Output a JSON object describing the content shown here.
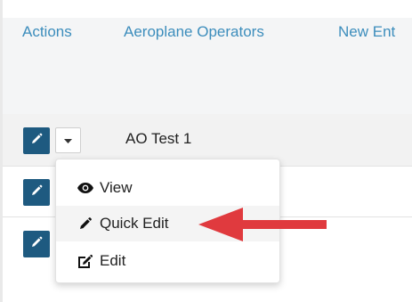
{
  "header": {
    "columns": [
      {
        "label": "Actions"
      },
      {
        "label": "Aeroplane Operators"
      },
      {
        "label": "New Ent"
      }
    ]
  },
  "rows": [
    {
      "name": "AO Test 1"
    },
    {
      "name": ""
    },
    {
      "name": ""
    }
  ],
  "dropdown": {
    "items": [
      {
        "label": "View",
        "icon": "eye-icon"
      },
      {
        "label": "Quick Edit",
        "icon": "pencil-icon"
      },
      {
        "label": "Edit",
        "icon": "edit-square-icon"
      }
    ]
  },
  "colors": {
    "link": "#3c8dbc",
    "edit_button": "#1e5a80",
    "annotation_arrow": "#e03a3e"
  }
}
